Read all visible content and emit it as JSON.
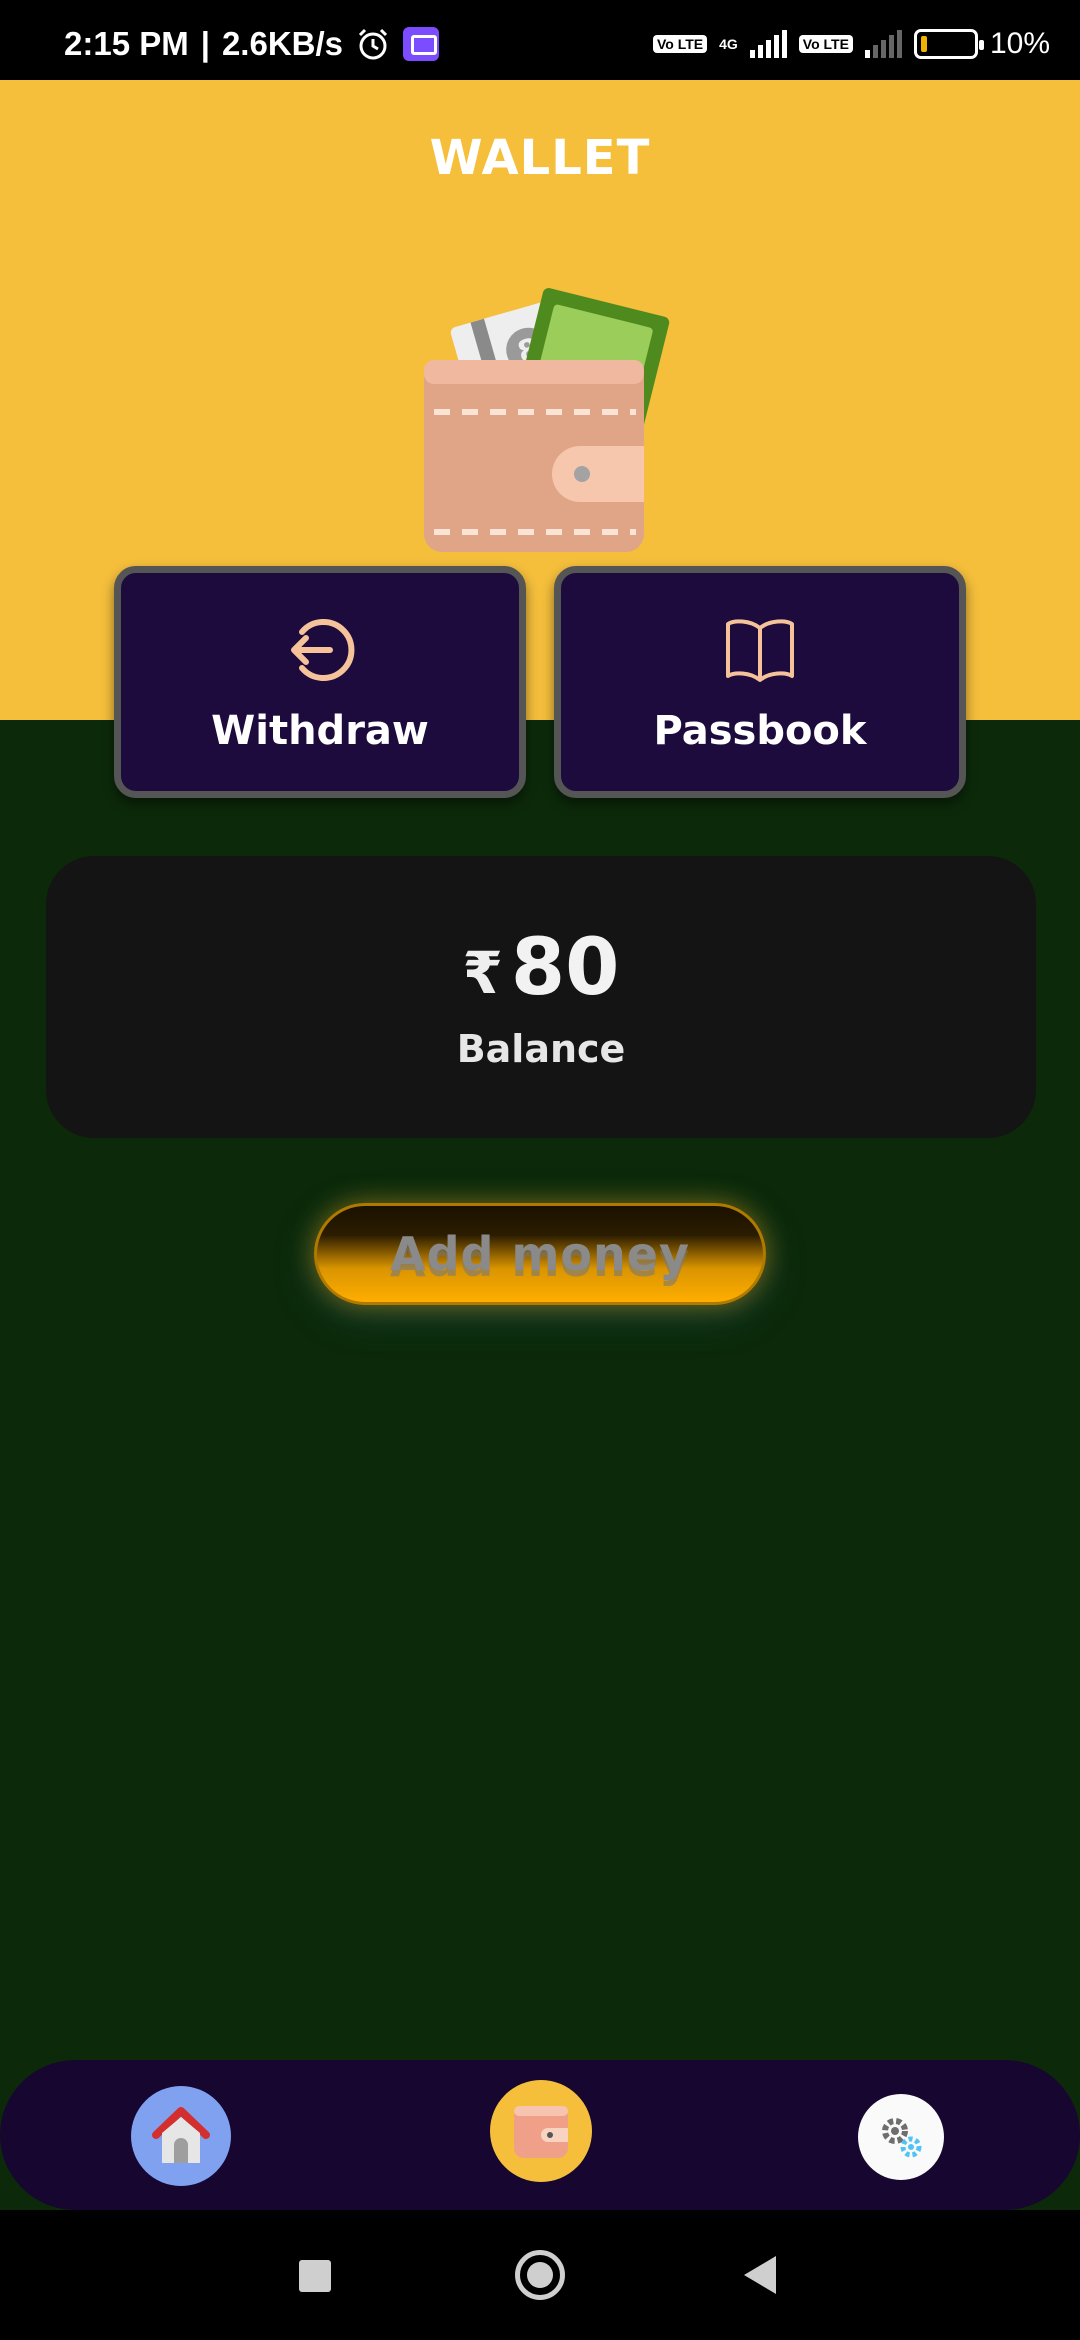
{
  "status_bar": {
    "time": "2:15 PM",
    "separator": "|",
    "net_speed": "2.6KB/s",
    "sim1_badge": "Vo LTE",
    "network_type": "4G",
    "sim2_badge": "Vo LTE",
    "battery_percent": "10%",
    "icons": [
      "alarm-icon",
      "message-icon",
      "signal-icon",
      "battery-icon"
    ]
  },
  "header": {
    "title": "WALLET"
  },
  "actions": {
    "withdraw_label": "Withdraw",
    "passbook_label": "Passbook"
  },
  "balance": {
    "currency_symbol": "₹",
    "amount": "80",
    "label": "Balance"
  },
  "add_money": {
    "label": "Add money"
  },
  "bottom_nav": {
    "items": [
      {
        "name": "home",
        "icon": "home-icon"
      },
      {
        "name": "wallet",
        "icon": "wallet-icon",
        "active": true
      },
      {
        "name": "settings",
        "icon": "gear-icon"
      }
    ]
  },
  "colors": {
    "header_bg": "#f5bf3c",
    "body_bg": "#0c2a0a",
    "action_card_bg": "#1d0b3e",
    "balance_card_bg": "#141414",
    "add_money_accent": "#ffae00",
    "nav_bg": "#160630"
  }
}
